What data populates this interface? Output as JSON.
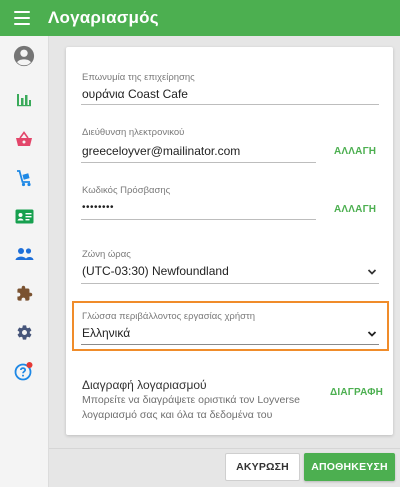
{
  "app": {
    "title": "Λογαριασμός"
  },
  "colors": {
    "accent": "#4caf50",
    "highlight": "#f08c2a",
    "badge": "#e53935",
    "icon_green": "#3aaa5a",
    "icon_pink": "#e3466a",
    "icon_blue": "#1e88e5",
    "icon_grey": "#616161"
  },
  "sidebar": {
    "items": [
      {
        "name": "account-circle-icon"
      },
      {
        "name": "bar-chart-icon"
      },
      {
        "name": "shopping-basket-icon"
      },
      {
        "name": "items-cart-icon"
      },
      {
        "name": "id-card-icon"
      },
      {
        "name": "people-icon"
      },
      {
        "name": "puzzle-icon"
      },
      {
        "name": "gear-icon"
      },
      {
        "name": "help-icon",
        "badge": true
      }
    ]
  },
  "form": {
    "business_name": {
      "label": "Επωνυμία της επιχείρησης",
      "value": "ουράνια Coast Cafe"
    },
    "email": {
      "label": "Διεύθυνση ηλεκτρονικού",
      "value": "greeceloyver@mailinator.com",
      "action": "ΑΛΛΑΓΗ"
    },
    "password": {
      "label": "Κωδικός Πρόσβασης",
      "value": "••••••••",
      "action": "ΑΛΛΑΓΗ"
    },
    "timezone": {
      "label": "Ζώνη ώρας",
      "value": "(UTC-03:30) Newfoundland"
    },
    "language": {
      "label": "Γλώσσα περιβάλλοντος εργασίας χρήστη",
      "value": "Ελληνικά"
    }
  },
  "delete_account": {
    "title": "Διαγραφή λογαριασμού",
    "description": "Μπορείτε να διαγράψετε οριστικά τον Loyverse λογαριασμό σας και όλα τα δεδομένα του",
    "action": "ΔΙΑΓΡΑΦΗ"
  },
  "footer": {
    "cancel_label": "ΑΚΥΡΩΣΗ",
    "save_label": "ΑΠΟΘΗΚΕΥΣΗ"
  }
}
